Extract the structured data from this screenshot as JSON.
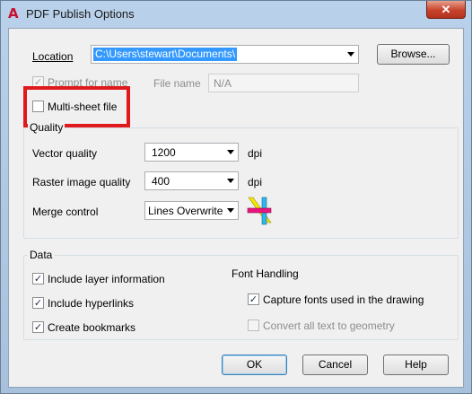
{
  "window": {
    "title": "PDF Publish Options",
    "close_label": "✕"
  },
  "location": {
    "label": "Location",
    "value": "C:\\Users\\stewart\\Documents\\",
    "browse_label": "Browse..."
  },
  "prompt_for_name": {
    "label": "Prompt for name",
    "checked": true,
    "enabled": false
  },
  "file_name": {
    "label": "File name",
    "value": "N/A"
  },
  "multi_sheet": {
    "label": "Multi-sheet file",
    "checked": false
  },
  "quality": {
    "title": "Quality",
    "vector": {
      "label": "Vector quality",
      "value": "1200",
      "unit": "dpi"
    },
    "raster": {
      "label": "Raster image quality",
      "value": "400",
      "unit": "dpi"
    },
    "merge": {
      "label": "Merge control",
      "value": "Lines Overwrite"
    }
  },
  "data": {
    "title": "Data",
    "include_layer": {
      "label": "Include layer information",
      "checked": true
    },
    "include_hyperlinks": {
      "label": "Include hyperlinks",
      "checked": true
    },
    "create_bookmarks": {
      "label": "Create bookmarks",
      "checked": true
    },
    "font_handling": {
      "title": "Font Handling",
      "capture_fonts": {
        "label": "Capture fonts used in the drawing",
        "checked": true
      },
      "convert_text": {
        "label": "Convert all text to geometry",
        "checked": false,
        "enabled": false
      }
    }
  },
  "buttons": {
    "ok": "OK",
    "cancel": "Cancel",
    "help": "Help"
  },
  "colors": {
    "highlight": "#e0191c",
    "selection": "#3399ff",
    "close": "#c7432b"
  }
}
